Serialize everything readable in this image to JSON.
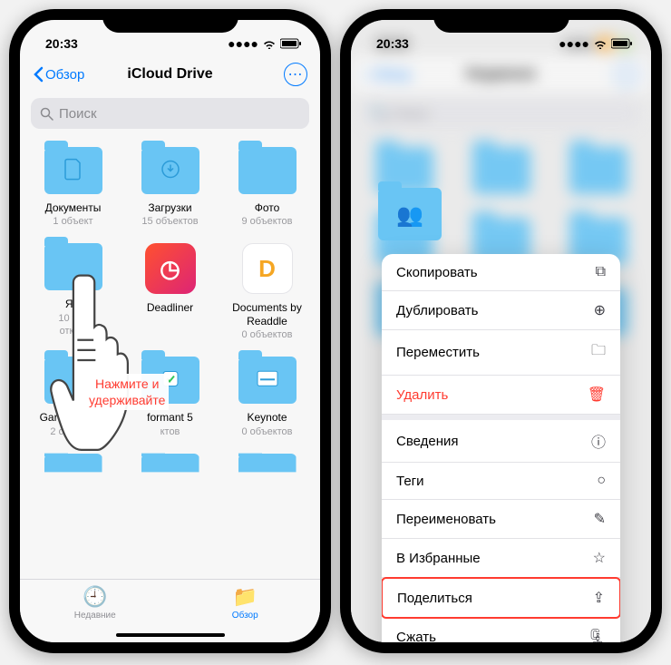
{
  "left": {
    "status": {
      "time": "20:33"
    },
    "nav": {
      "back": "Обзор",
      "title": "iCloud Drive"
    },
    "search": {
      "placeholder": "Поиск"
    },
    "items": [
      {
        "name": "Документы",
        "meta": "1 объект",
        "kind": "folder",
        "glyph": "doc"
      },
      {
        "name": "Загрузки",
        "meta": "15 объектов",
        "kind": "folder",
        "glyph": "down"
      },
      {
        "name": "Фото",
        "meta": "9 объектов",
        "kind": "folder",
        "glyph": ""
      },
      {
        "name": "Я      к",
        "meta": "10       тов",
        "kind": "folder",
        "glyph": "",
        "sub": "откры"
      },
      {
        "name": "Deadliner",
        "meta": "",
        "kind": "app",
        "bg": "linear-gradient(135deg,#ff512f,#dd2476)",
        "glyph": "◷"
      },
      {
        "name": "Documents by Readdle",
        "meta": "0 объектов",
        "kind": "app",
        "bg": "#fff",
        "glyph": "D",
        "gcolor": "#f5a623",
        "border": "1px solid #e5e5e9"
      },
      {
        "name": "Gara          для iOS",
        "meta": "2 объекта",
        "kind": "folder",
        "glyph": ""
      },
      {
        "name": "formant 5",
        "meta": "ктов",
        "kind": "folder",
        "glyph": "check"
      },
      {
        "name": "Keynote",
        "meta": "0 объектов",
        "kind": "folder",
        "glyph": "key"
      }
    ],
    "pointer_text": "Нажмите и\nудерживайте",
    "tabs": {
      "recent": "Недавние",
      "browse": "Обзор"
    }
  },
  "right": {
    "status": {
      "time": "20:33"
    },
    "menu": [
      {
        "label": "Скопировать",
        "icon": "copy"
      },
      {
        "label": "Дублировать",
        "icon": "dup"
      },
      {
        "label": "Переместить",
        "icon": "folder"
      },
      {
        "label": "Удалить",
        "icon": "trash",
        "danger": true
      },
      {
        "sep": true
      },
      {
        "label": "Сведения",
        "icon": "info"
      },
      {
        "label": "Теги",
        "icon": "tag"
      },
      {
        "label": "Переименовать",
        "icon": "pencil"
      },
      {
        "label": "В Избранные",
        "icon": "star"
      },
      {
        "label": "Поделиться",
        "icon": "share",
        "highlighted": true
      },
      {
        "label": "Сжать",
        "icon": "archive"
      }
    ]
  }
}
